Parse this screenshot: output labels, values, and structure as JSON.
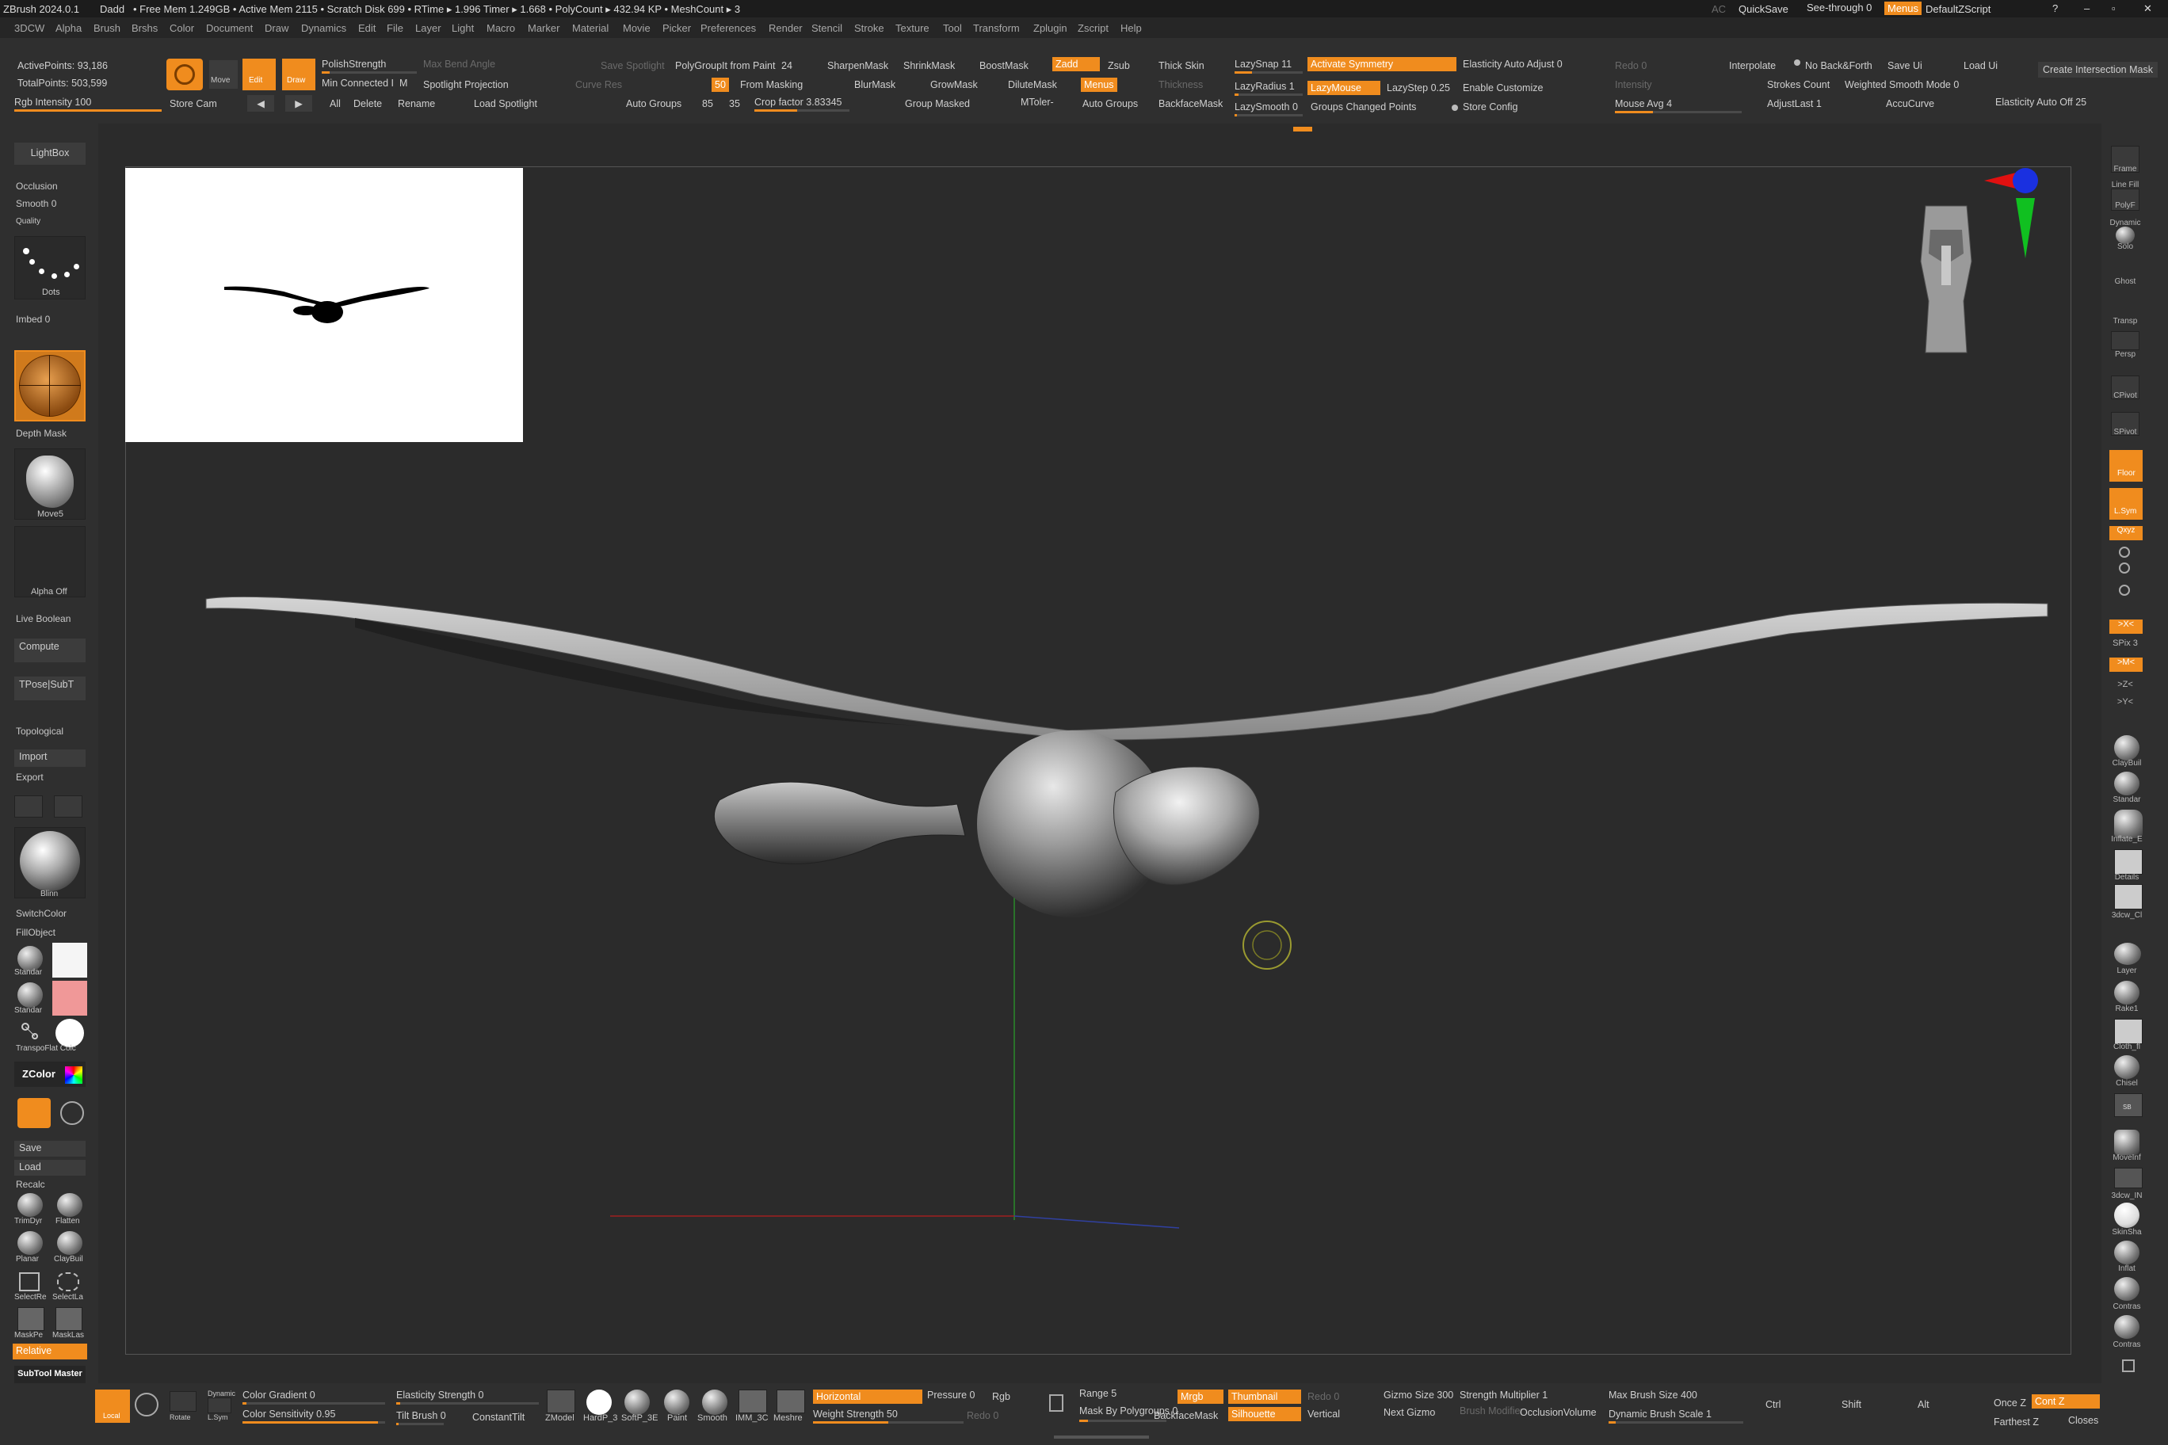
{
  "title_bar": {
    "app": "ZBrush 2024.0.1",
    "project": "Dadd",
    "stats": "• Free Mem 1.249GB • Active Mem 2115 • Scratch Disk 699 • RTime ▸ 1.996 Timer ▸ 1.668 • PolyCount ▸ 432.94 KP • MeshCount ▸ 3",
    "ac": "AC",
    "quicksave": "QuickSave",
    "see_through": "See-through 0",
    "menus": "Menus",
    "default_zscript": "DefaultZScript"
  },
  "menu": [
    "3DCW",
    "Alpha",
    "Brush",
    "Brshs",
    "Color",
    "Document",
    "Draw",
    "Dynamics",
    "Edit",
    "File",
    "Layer",
    "Light",
    "Macro",
    "Marker",
    "Material",
    "Movie",
    "Picker",
    "Preferences",
    "Render",
    "Stencil",
    "Stroke",
    "Texture",
    "Tool",
    "Transform",
    "Zplugin",
    "Zscript",
    "Help"
  ],
  "top_shelf": {
    "active_points": "ActivePoints: 93,186",
    "total_points": "TotalPoints: 503,599",
    "rgb_intensity": "Rgb Intensity 100",
    "store_cam": "Store Cam",
    "all": "All",
    "delete": "Delete",
    "rename": "Rename",
    "move": "Move",
    "edit": "Edit",
    "draw": "Draw",
    "polish_strength": "PolishStrength",
    "min_connected": "Min Connected I",
    "m": "M",
    "max_bend_angle": "Max Bend Angle",
    "spotlight_projection": "Spotlight Projection",
    "load_spotlight": "Load Spotlight",
    "save_spotlight": "Save Spotlight",
    "curve_res": "Curve Res",
    "auto_groups": "Auto Groups",
    "v85": "85",
    "v35": "35",
    "polygroupit": "PolyGroupIt from Paint",
    "v24": "24",
    "v50": "50",
    "from_masking": "From Masking",
    "crop_factor": "Crop factor 3.83345",
    "sharpen_mask": "SharpenMask",
    "shrink_mask": "ShrinkMask",
    "boost_mask": "BoostMask",
    "blur_mask": "BlurMask",
    "grow_mask": "GrowMask",
    "dilute_mask": "DiluteMask",
    "group_masked": "Group Masked",
    "mtoler": "MToler-",
    "zadd": "Zadd",
    "zsub": "Zsub",
    "menus_btn": "Menus",
    "auto_groups2": "Auto Groups",
    "thick_skin": "Thick Skin",
    "thickness": "Thickness",
    "backface_mask": "BackfaceMask",
    "lazysnap": "LazySnap 11",
    "lazyradius": "LazyRadius 1",
    "lazysmooth": "LazySmooth 0",
    "activate_symmetry": "Activate Symmetry",
    "lazymouse": "LazyMouse",
    "lazystep": "LazyStep 0.25",
    "groups_changed": "Groups Changed Points",
    "elasticity_auto_adjust": "Elasticity Auto Adjust 0",
    "enable_customize": "Enable Customize",
    "store_config": "Store Config",
    "redo": "Redo 0",
    "intensity": "Intensity",
    "mouse_avg": "Mouse Avg 4",
    "interpolate": "Interpolate",
    "no_back_forth": "No Back&Forth",
    "strokes_count": "Strokes Count",
    "weighted_smooth": "Weighted Smooth Mode 0",
    "adjust_last": "AdjustLast 1",
    "accucurve": "AccuCurve",
    "save_ui": "Save Ui",
    "load_ui": "Load Ui",
    "elasticity_auto_off": "Elasticity Auto Off 25",
    "create_intersection": "Create Intersection Mask"
  },
  "left_tray": {
    "lightbox": "LightBox",
    "occlusion": "Occlusion",
    "smooth": "Smooth 0",
    "quality": "Quality",
    "dots": "Dots",
    "imbed": "Imbed 0",
    "depth_mask": "Depth Mask",
    "move5": "Move5",
    "alpha_off": "Alpha Off",
    "live_boolean": "Live Boolean",
    "compute": "Compute",
    "tpose": "TPose|SubT",
    "topological": "Topological",
    "import": "Import",
    "export": "Export",
    "blinn": "Blinn",
    "switch_color": "SwitchColor",
    "fill_object": "FillObject",
    "standar1": "Standar",
    "standar2": "Standar",
    "transpo": "TranspoFlat Colc",
    "zcolor": "ZColor",
    "save": "Save",
    "load": "Load",
    "recalc": "Recalc",
    "trimdyn": "TrimDyr",
    "flatten": "Flatten",
    "planar": "Planar",
    "claybuil": "ClayBuil",
    "selectre": "SelectRe",
    "selectla": "SelectLa",
    "maskpe": "MaskPe",
    "masklas": "MaskLas",
    "relative": "Relative",
    "subtool_master": "SubTool Master"
  },
  "right_tray": {
    "frame": "Frame",
    "line_fill": "Line Fill",
    "polyf": "PolyF",
    "dynamic": "Dynamic",
    "solo": "Solo",
    "ghost": "Ghost",
    "transp": "Transp",
    "persp": "Persp",
    "cpivot": "CPivot",
    "spivot": "SPivot",
    "floor": "Floor",
    "lsym": "L.Sym",
    "xyz": "Qxyz",
    "x_axis": ">X<",
    "spix": "SPix 3",
    "m_axis": ">M<",
    "z_axis": ">Z<",
    "y_axis": ">Y<",
    "claybuil": "ClayBuil",
    "standar": "Standar",
    "inflate": "Inflate_E",
    "details": "Details",
    "3dcw": "3dcw_Cl",
    "layer": "Layer",
    "rake1": "Rake1",
    "cloth": "Cloth_fl",
    "chisel": "Chisel",
    "sb": "SB",
    "move_inf": "MoveInf",
    "3dcw_h": "3dcw_IN",
    "skinsha": "SkinSha",
    "inflat": "Inflat",
    "contras1": "Contras",
    "contras2": "Contras"
  },
  "bottom_shelf": {
    "local": "Local",
    "rotate": "Rotate",
    "dynamic": "Dynamic",
    "lsym": "L.Sym",
    "color_gradient": "Color Gradient 0",
    "color_sensitivity": "Color Sensitivity 0.95",
    "elasticity_strength": "Elasticity Strength 0",
    "tilt_brush": "Tilt Brush 0",
    "constant_tilt": "ConstantTilt",
    "zmodel": "ZModel",
    "hardp": "HardP_3",
    "softp": "SoftP_3E",
    "paint": "Paint",
    "smooth": "Smooth",
    "imm": "IMM_3C",
    "meshre": "Meshre",
    "horizontal": "Horizontal",
    "pressure": "Pressure 0",
    "weight_strength": "Weight Strength 50",
    "rgb": "Rgb",
    "redo": "Redo 0",
    "range": "Range 5",
    "mask_by_polygroups": "Mask By Polygroups 0",
    "mrgb": "Mrgb",
    "backface_mask": "BackfaceMask",
    "thumbnail": "Thumbnail",
    "silhouette": "Silhouette",
    "redo2": "Redo 0",
    "vertical": "Vertical",
    "gizmo_size": "Gizmo Size 300",
    "next_gizmo": "Next Gizmo",
    "strength_multiplier": "Strength Multiplier 1",
    "brush_modifier": "Brush Modifier",
    "occlusion_volume": "OcclusionVolume",
    "max_brush_size": "Max Brush Size 400",
    "dynamic_brush_scale": "Dynamic Brush Scale 1",
    "ctrl": "Ctrl",
    "shift": "Shift",
    "alt": "Alt",
    "once_z": "Once Z",
    "cont_z": "Cont Z",
    "farthest_z": "Farthest Z",
    "closes": "Closes"
  },
  "colors": {
    "accent": "#f08c1e",
    "panel": "#2f2f2f",
    "canvas": "#2b2b2b"
  }
}
